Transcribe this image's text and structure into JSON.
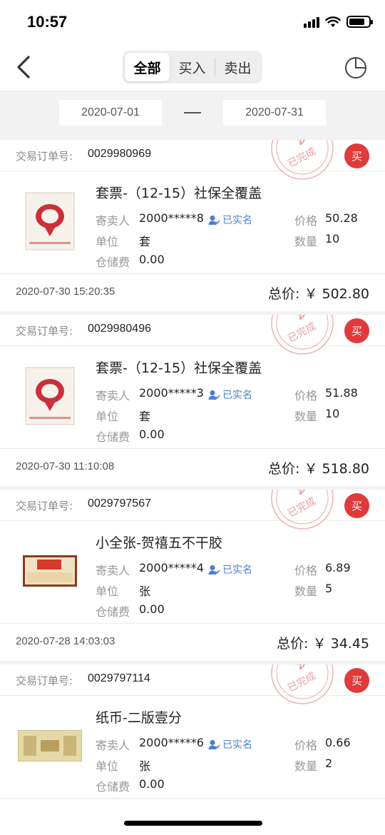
{
  "status_bar": {
    "time": "10:57",
    "icons": [
      "signal-icon",
      "wifi-icon",
      "battery-icon"
    ]
  },
  "nav": {
    "back_icon": "chevron-left-icon",
    "tabs": [
      {
        "label": "全部",
        "active": true
      },
      {
        "label": "买入",
        "active": false
      },
      {
        "label": "卖出",
        "active": false
      }
    ],
    "pie_icon": "pie-chart-icon"
  },
  "date_range": {
    "start": "2020-07-01",
    "end": "2020-07-31"
  },
  "labels": {
    "order_no": "交易订单号:",
    "seller": "寄卖人",
    "unit": "单位",
    "storage_fee": "仓储费",
    "price": "价格",
    "quantity": "数量",
    "verified": "已实名",
    "total": "总价:",
    "buy_badge": "买",
    "completed_stamp": "已完成"
  },
  "orders": [
    {
      "order_no": "0029980969",
      "name": "套票-（12-15）社保全覆盖",
      "seller": "2000*****8",
      "unit": "套",
      "storage_fee": "0.00",
      "price": "50.28",
      "quantity": "10",
      "time": "2020-07-30 15:20:35",
      "total": "￥ 502.80",
      "thumb": "stamp-lantern"
    },
    {
      "order_no": "0029980496",
      "name": "套票-（12-15）社保全覆盖",
      "seller": "2000*****3",
      "unit": "套",
      "storage_fee": "0.00",
      "price": "51.88",
      "quantity": "10",
      "time": "2020-07-30 11:10:08",
      "total": "￥ 518.80",
      "thumb": "stamp-lantern"
    },
    {
      "order_no": "0029797567",
      "name": "小全张-贺禧五不干胶",
      "seller": "2000*****4",
      "unit": "张",
      "storage_fee": "0.00",
      "price": "6.89",
      "quantity": "5",
      "time": "2020-07-28 14:03:03",
      "total": "￥ 34.45",
      "thumb": "stamp-sheet"
    },
    {
      "order_no": "0029797114",
      "name": "纸币-二版壹分",
      "seller": "2000*****6",
      "unit": "张",
      "storage_fee": "0.00",
      "price": "0.66",
      "quantity": "2",
      "time": "",
      "total": "",
      "thumb": "banknote"
    }
  ]
}
